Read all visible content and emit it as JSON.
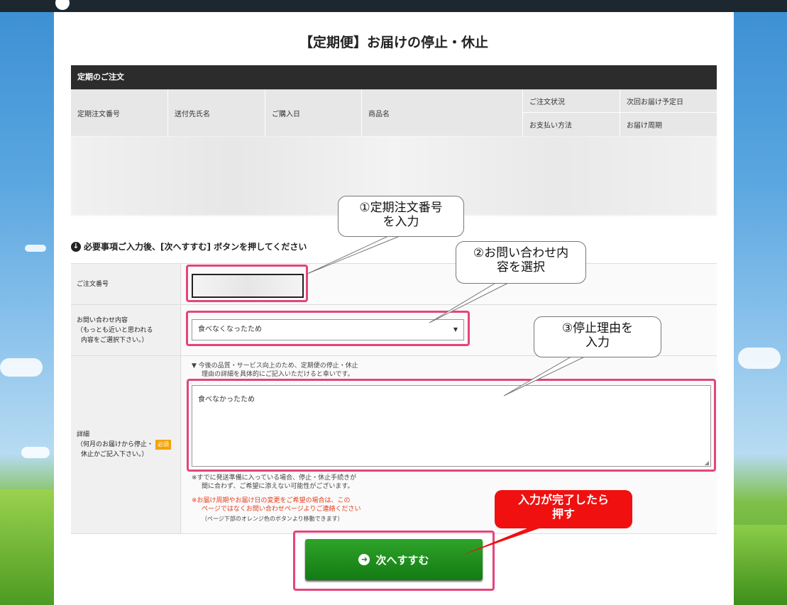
{
  "page_title": "【定期便】お届けの停止・休止",
  "order_section": {
    "header": "定期のご注文",
    "columns": [
      "定期注文番号",
      "送付先氏名",
      "ご購入日",
      "商品名"
    ],
    "stacked_columns": [
      {
        "top": "ご注文状況",
        "bottom": "お支払い方法"
      },
      {
        "top": "次回お届け予定日",
        "bottom": "お届け周期"
      }
    ]
  },
  "instruction": "必要事項ご入力後、[次へすすむ] ボタンを押してください",
  "form": {
    "order_number": {
      "label": "ご注文番号",
      "value": ""
    },
    "inquiry": {
      "label": "お問い合わせ内容",
      "sublabel1": "（もっとも近いと思われる",
      "sublabel2": "内容をご選択下さい。）",
      "selected": "食べなくなったため"
    },
    "details": {
      "label": "詳細",
      "sublabel1": "（何月のお届けから停止・",
      "sublabel2": "休止かご記入下さい。）",
      "required_badge": "必須",
      "note_top1": "▼ 今後の品質・サービス向上のため、定期便の停止・休止",
      "note_top2": "理由の詳細を具体的にご記入いただけると幸いです。",
      "value": "食べなかったため",
      "note1a": "※すでに発送準備に入っている場合、停止・休止手続きが",
      "note1b": "間に合わず、ご希望に添えない可能性がございます。",
      "note2a": "※お届け周期やお届け日の変更をご希望の場合は、この",
      "note2b": "ページではなくお問い合わせページよりご連絡ください",
      "note3": "（ページ下部のオレンジ色のボタンより移動できます）"
    }
  },
  "next_button": "次へすすむ",
  "callouts": {
    "c1a": "①定期注文番号",
    "c1b": "を入力",
    "c2a": "②お問い合わせ内",
    "c2b": "容を選択",
    "c3a": "③停止理由を",
    "c3b": "入力",
    "c4a": "入力が完了したら",
    "c4b": "押す"
  },
  "colors": {
    "highlight": "#e4457c",
    "button": "#1a8a1a",
    "callout_red": "#f01010",
    "header_dark": "#2c2c2c"
  }
}
